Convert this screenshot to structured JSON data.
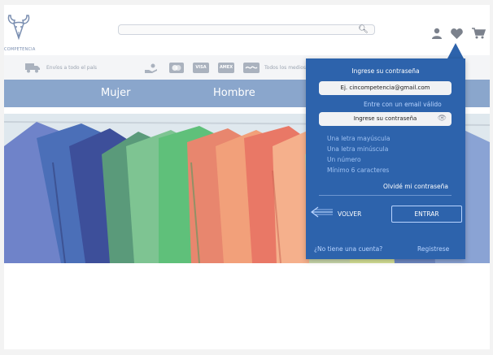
{
  "header": {
    "logo_text": "COMPETENCIA",
    "search": {
      "placeholder": ""
    },
    "icons": [
      "user-icon",
      "heart-icon",
      "cart-icon"
    ]
  },
  "infobar": {
    "shipping": "Envíos a todo el país",
    "payments": "Todos los medios de pago",
    "cards": [
      "VISA",
      "AMEX"
    ]
  },
  "nav": {
    "items": [
      "Mujer",
      "Hombre"
    ]
  },
  "hero": {
    "slides": 3
  },
  "login": {
    "title": "Ingrese su contraseña",
    "email_value": "Ej. cincompetencia@gmail.com",
    "email_hint": "Entre con un email válido",
    "password_placeholder": "Ingrese su contraseña",
    "rules": [
      "Una letra mayúscula",
      "Una letra minúscula",
      "Un número",
      "Mínimo 6 caracteres"
    ],
    "forgot": "Olvidé mi contraseña",
    "back": "VOLVER",
    "enter": "ENTRAR",
    "no_account": "¿No tiene una cuenta?",
    "register": "Registrese"
  },
  "colors": {
    "popup": "#2d63ac",
    "nav": "#8aa6cc",
    "link": "#b8d4ff"
  }
}
